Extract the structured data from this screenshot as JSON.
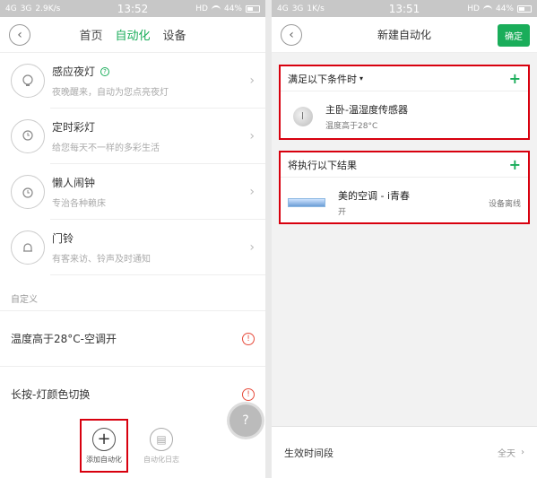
{
  "left_screen": {
    "status": {
      "signal1": "4G",
      "signal2": "3G",
      "speed": "2.9K/s",
      "time": "13:52",
      "hd": "HD",
      "battery": "44%"
    },
    "nav": {
      "back_icon": "chevron-left-icon",
      "tabs": [
        "首页",
        "自动化",
        "设备"
      ],
      "active_tab": "自动化"
    },
    "automations": [
      {
        "title": "感应夜灯",
        "desc": "夜晚醒来，自动为您点亮夜灯",
        "icon": "bulb-icon",
        "help": "?"
      },
      {
        "title": "定时彩灯",
        "desc": "给您每天不一样的多彩生活",
        "icon": "timer-bulb-icon"
      },
      {
        "title": "懒人闹钟",
        "desc": "专治各种赖床",
        "icon": "alarm-clock-icon"
      },
      {
        "title": "门铃",
        "desc": "有客来访、铃声及时通知",
        "icon": "bell-icon"
      }
    ],
    "custom_label": "自定义",
    "custom_items": [
      {
        "title": "温度高于28°C-空调开",
        "warn": "!"
      },
      {
        "title": "长按-灯颜色切换",
        "warn": "!"
      }
    ],
    "bottom": {
      "add_label": "添加自动化",
      "add_icon": "+",
      "log_label": "自动化日志",
      "log_icon": "▤"
    },
    "float_help": "?"
  },
  "right_screen": {
    "status": {
      "signal1": "4G",
      "signal2": "3G",
      "speed": "1K/s",
      "time": "13:51",
      "hd": "HD",
      "battery": "44%"
    },
    "nav": {
      "title": "新建自动化",
      "confirm": "确定"
    },
    "condition_panel": {
      "header": "满足以下条件时",
      "caret": "▾",
      "plus": "+",
      "device": {
        "name": "主卧-温湿度传感器",
        "sub": "温度高于28°C"
      }
    },
    "result_panel": {
      "header": "将执行以下结果",
      "plus": "+",
      "device": {
        "name": "美的空调 - i青春",
        "sub": "开",
        "status": "设备离线"
      }
    },
    "effective": {
      "label": "生效时间段",
      "value": "全天",
      "chevron": "›"
    }
  },
  "colors": {
    "accent": "#1aad5a",
    "highlight_box": "#d8000e",
    "warning": "#e74c3c"
  }
}
